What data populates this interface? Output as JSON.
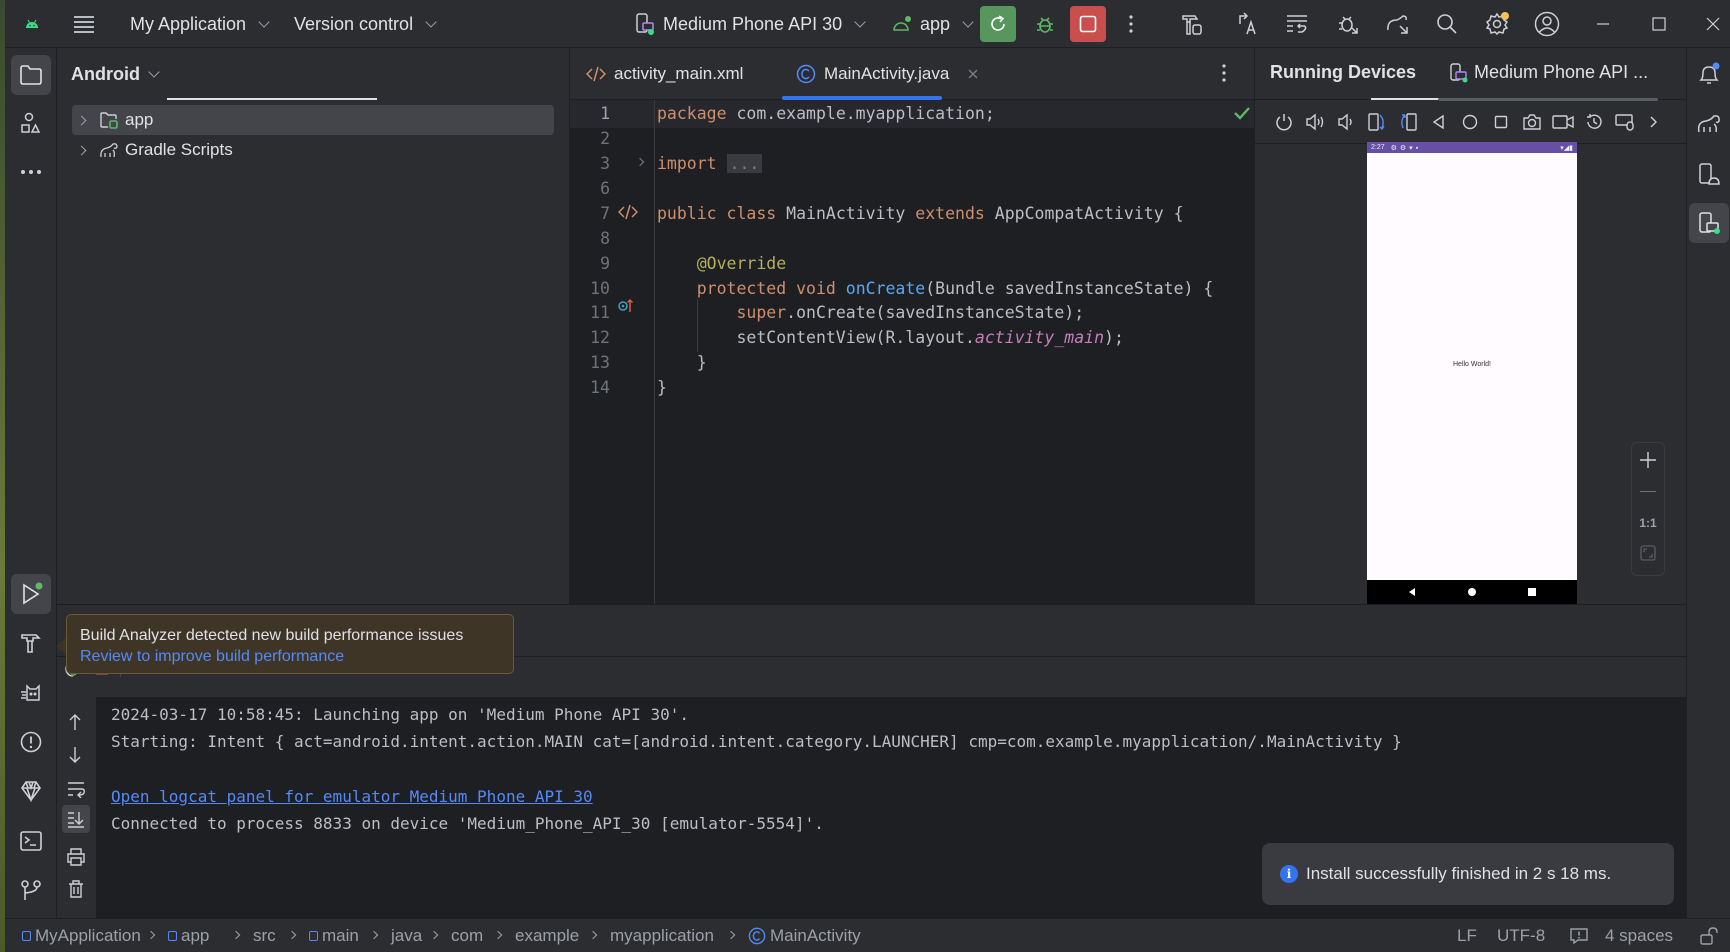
{
  "titlebar": {
    "project_name": "My Application",
    "vcs_label": "Version control",
    "device_selector": "Medium Phone API 30",
    "run_config": "app"
  },
  "project_panel": {
    "view_label": "Android",
    "tree": [
      {
        "label": "app",
        "selected": true
      },
      {
        "label": "Gradle Scripts",
        "selected": false
      }
    ]
  },
  "editor": {
    "tabs": [
      {
        "label": "activity_main.xml",
        "active": false
      },
      {
        "label": "MainActivity.java",
        "active": true
      }
    ],
    "lines": [
      {
        "num": "1",
        "tokens": [
          [
            "kw",
            "package"
          ],
          [
            "t",
            " com.example.myapplication;"
          ]
        ]
      },
      {
        "num": "2",
        "tokens": []
      },
      {
        "num": "3",
        "tokens": [
          [
            "kw",
            "import"
          ],
          [
            "t",
            " "
          ],
          [
            "fold",
            "..."
          ]
        ]
      },
      {
        "num": "6",
        "tokens": []
      },
      {
        "num": "7",
        "tokens": [
          [
            "kw",
            "public class"
          ],
          [
            "t",
            " MainActivity "
          ],
          [
            "kw",
            "extends"
          ],
          [
            "t",
            " AppCompatActivity {"
          ]
        ]
      },
      {
        "num": "8",
        "tokens": []
      },
      {
        "num": "9",
        "tokens": [
          [
            "t",
            "    "
          ],
          [
            "ann",
            "@Override"
          ]
        ]
      },
      {
        "num": "10",
        "tokens": [
          [
            "t",
            "    "
          ],
          [
            "kw",
            "protected void"
          ],
          [
            "t",
            " "
          ],
          [
            "fn",
            "onCreate"
          ],
          [
            "t",
            "(Bundle savedInstanceState) {"
          ]
        ]
      },
      {
        "num": "11",
        "tokens": [
          [
            "t",
            "        "
          ],
          [
            "kw",
            "super"
          ],
          [
            "t",
            ".onCreate(savedInstanceState);"
          ]
        ]
      },
      {
        "num": "12",
        "tokens": [
          [
            "t",
            "        setContentView(R.layout."
          ],
          [
            "fld",
            "activity_main"
          ],
          [
            "t",
            ");"
          ]
        ]
      },
      {
        "num": "13",
        "tokens": [
          [
            "t",
            "    }"
          ]
        ]
      },
      {
        "num": "14",
        "tokens": [
          [
            "t",
            "}"
          ]
        ]
      }
    ]
  },
  "running_devices": {
    "title": "Running Devices",
    "device_tab": "Medium Phone API ...",
    "phone": {
      "status_time": "2:27",
      "screen_text": "Hello World!"
    },
    "zoom": {
      "actual_size_label": "1:1"
    }
  },
  "tooltip": {
    "message": "Build Analyzer detected new build performance issues",
    "link": "Review to improve build performance"
  },
  "console": {
    "lines": [
      {
        "text": "2024-03-17 10:58:45: Launching app on 'Medium Phone API 30'.",
        "link": false
      },
      {
        "text": "Starting: Intent { act=android.intent.action.MAIN cat=[android.intent.category.LAUNCHER] cmp=com.example.myapplication/.MainActivity }",
        "link": false
      },
      {
        "text": "",
        "link": false
      },
      {
        "text": "Open logcat panel for emulator Medium Phone API 30",
        "link": true
      },
      {
        "text": "Connected to process 8833 on device 'Medium_Phone_API_30 [emulator-5554]'.",
        "link": false
      }
    ]
  },
  "notification": {
    "message": "Install successfully finished in 2 s 18 ms."
  },
  "statusbar": {
    "breadcrumbs": [
      "MyApplication",
      "app",
      "src",
      "main",
      "java",
      "com",
      "example",
      "myapplication",
      "MainActivity"
    ],
    "line_ending": "LF",
    "encoding": "UTF-8",
    "indent": "4 spaces"
  },
  "colors": {
    "accent": "#3574f0",
    "run_green": "#57965c",
    "stop_red": "#c94f4f",
    "link": "#548af7",
    "phone_status": "#6750a4"
  }
}
